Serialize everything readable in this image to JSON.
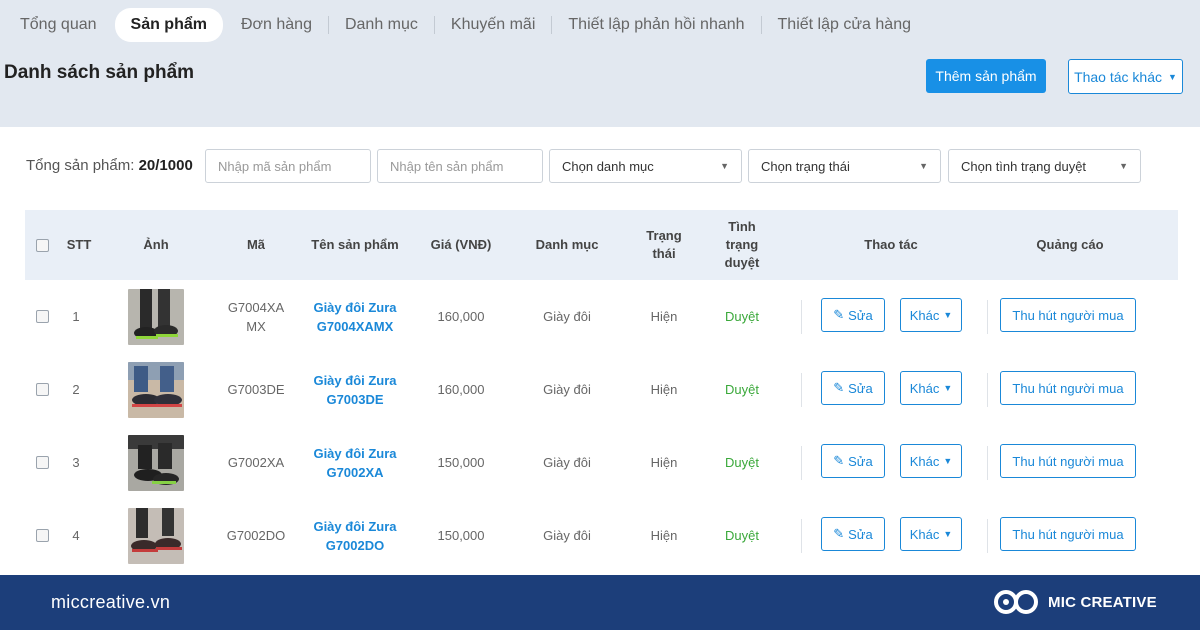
{
  "tabs": [
    {
      "label": "Tổng quan",
      "active": false
    },
    {
      "label": "Sản phẩm",
      "active": true
    },
    {
      "label": "Đơn hàng",
      "active": false
    },
    {
      "label": "Danh mục",
      "active": false
    },
    {
      "label": "Khuyến mãi",
      "active": false
    },
    {
      "label": "Thiết lập phản hồi nhanh",
      "active": false
    },
    {
      "label": "Thiết lập cửa hàng",
      "active": false
    }
  ],
  "header": {
    "title": "Danh sách sản phẩm",
    "add_button": "Thêm sản phẩm",
    "more_button": "Thao tác khác"
  },
  "filters": {
    "total_label": "Tổng sản phẩm:",
    "total_value": "20/1000",
    "code_placeholder": "Nhập mã sản phẩm",
    "name_placeholder": "Nhập tên sản phẩm",
    "category_select": "Chọn danh mục",
    "status_select": "Chọn trạng thái",
    "review_select": "Chọn tình trạng duyệt"
  },
  "table": {
    "headers": {
      "stt": "STT",
      "image": "Ảnh",
      "code": "Mã",
      "name": "Tên sản phẩm",
      "price": "Giá (VNĐ)",
      "category": "Danh mục",
      "status": "Trạng thái",
      "review": "Tình trạng duyệt",
      "actions": "Thao tác",
      "ads": "Quảng cáo"
    },
    "rows": [
      {
        "stt": "1",
        "code": "G7004XA MX",
        "name": "Giày đôi Zura G7004XAMX",
        "price": "160,000",
        "category": "Giày đôi",
        "status": "Hiện",
        "review": "Duyệt"
      },
      {
        "stt": "2",
        "code": "G7003DE",
        "name": "Giày đôi Zura G7003DE",
        "price": "160,000",
        "category": "Giày đôi",
        "status": "Hiện",
        "review": "Duyệt"
      },
      {
        "stt": "3",
        "code": "G7002XA",
        "name": "Giày đôi Zura G7002XA",
        "price": "150,000",
        "category": "Giày đôi",
        "status": "Hiện",
        "review": "Duyệt"
      },
      {
        "stt": "4",
        "code": "G7002DO",
        "name": "Giày đôi Zura G7002DO",
        "price": "150,000",
        "category": "Giày đôi",
        "status": "Hiện",
        "review": "Duyệt"
      }
    ],
    "edit_label": "Sửa",
    "other_label": "Khác",
    "ad_label": "Thu hút người mua"
  },
  "footer": {
    "site": "miccreative.vn",
    "brand": "MIC CREATIVE"
  },
  "colors": {
    "accent": "#1a88d8",
    "approved": "#3aa83a",
    "footer_bg": "#1c3e7a"
  }
}
